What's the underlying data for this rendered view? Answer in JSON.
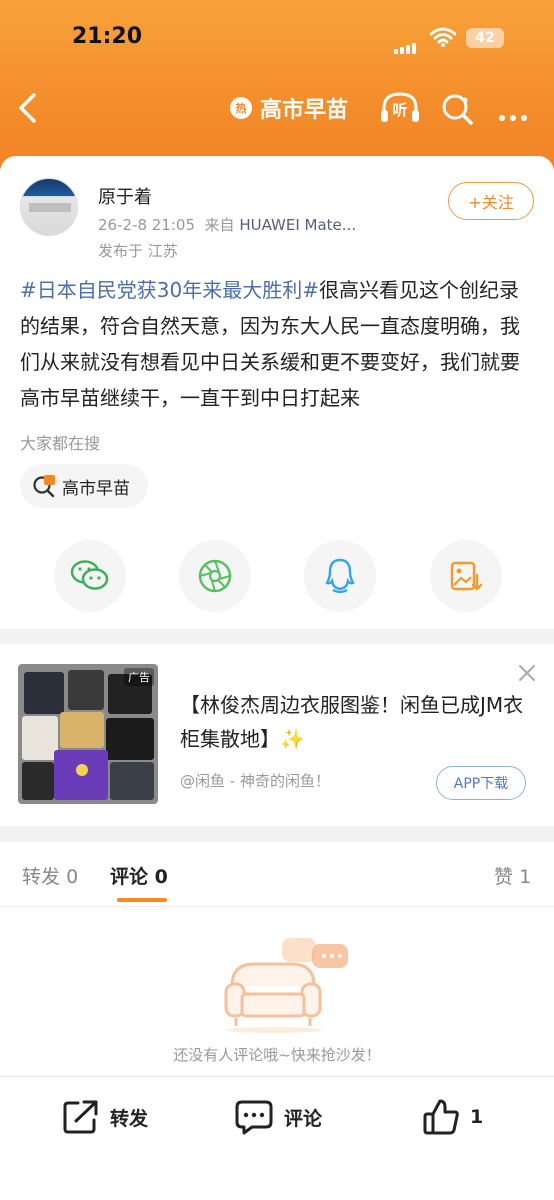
{
  "status_bar": {
    "time": "21:20",
    "battery": "42"
  },
  "nav": {
    "title": "高市早苗",
    "hot_badge": "热",
    "listen_label": "听"
  },
  "post": {
    "author": "原于着",
    "date": "26-2-8 21:05",
    "source_prefix": "来自",
    "device": "HUAWEI Mate...",
    "location": "发布于 江苏",
    "follow_label": "+关注",
    "hashtag": "#日本自民党获30年来最大胜利#",
    "body": "很高兴看见这个创纪录的结果，符合自然天意，因为东大人民一直态度明确，我们从来就没有想看见中日关系缓和更不要变好，我们就要高市早苗继续干，一直干到中日打起来",
    "hot_search_label": "大家都在搜",
    "hot_search_chip": "高市早苗"
  },
  "share_icons": [
    "wechat-icon",
    "moments-icon",
    "qq-icon",
    "save-image-icon"
  ],
  "ad": {
    "tag": "广告",
    "title": "【林俊杰周边衣服图鉴！闲鱼已成JM衣柜集散地】✨",
    "source": "@闲鱼 - 神奇的闲鱼！",
    "button": "APP下载"
  },
  "comments": {
    "tabs": [
      {
        "label": "转发",
        "count": "0"
      },
      {
        "label": "评论",
        "count": "0"
      },
      {
        "label": "赞",
        "count": "1"
      }
    ],
    "empty_text": "还没有人评论哦~快来抢沙发！"
  },
  "bottom_bar": {
    "repost_label": "转发",
    "comment_label": "评论",
    "like_count": "1"
  },
  "colors": {
    "accent": "#f5891f",
    "header_top": "#f7a23a",
    "link": "#4d6fa8"
  }
}
